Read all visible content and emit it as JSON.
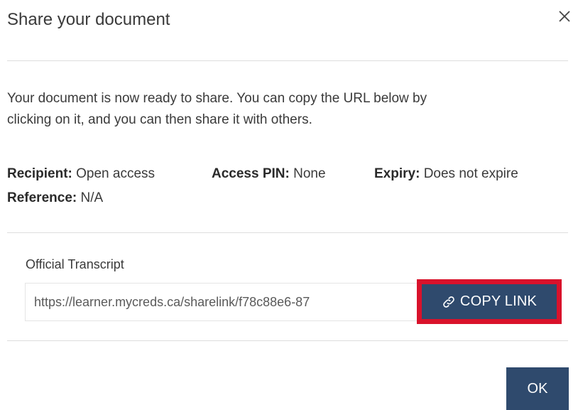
{
  "dialog": {
    "title": "Share your document",
    "close_icon": "close-icon",
    "intro_line1": "Your document is now ready to share. You can copy the URL below by",
    "intro_line2": "clicking on it, and you can then share it with others."
  },
  "details": {
    "recipient_label": "Recipient:",
    "recipient_value": "Open access",
    "pin_label": "Access PIN:",
    "pin_value": "None",
    "expiry_label": "Expiry:",
    "expiry_value": "Does not expire",
    "reference_label": "Reference:",
    "reference_value": "N/A"
  },
  "document": {
    "name": "Official Transcript",
    "share_url": "https://learner.mycreds.ca/sharelink/f78c88e6-87",
    "copy_label": "COPY LINK",
    "copy_icon": "link-icon"
  },
  "footer": {
    "ok_label": "OK"
  },
  "colors": {
    "button_bg": "#2f4a6d",
    "highlight_border": "#d9122b",
    "divider": "#dddddd"
  }
}
